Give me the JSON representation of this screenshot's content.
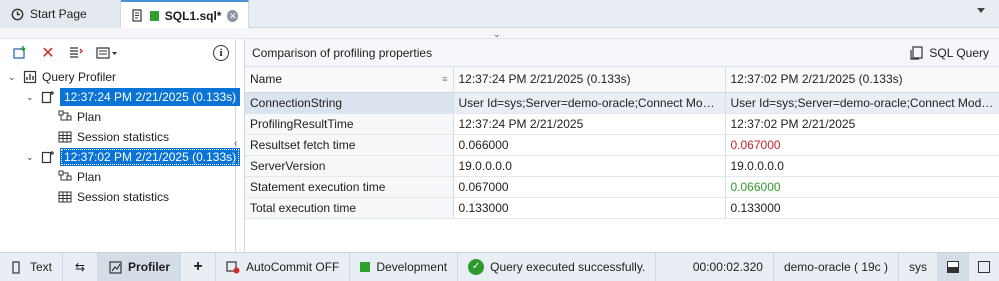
{
  "tabs": {
    "start_page": "Start Page",
    "sql_file": "SQL1.sql*"
  },
  "left": {
    "tree": {
      "root": "Query Profiler",
      "sessions": [
        {
          "label": "12:37:24 PM 2/21/2025 (0.133s)",
          "children": [
            "Plan",
            "Session statistics"
          ]
        },
        {
          "label": "12:37:02 PM 2/21/2025 (0.133s)",
          "children": [
            "Plan",
            "Session statistics"
          ]
        }
      ]
    }
  },
  "right": {
    "title": "Comparison of profiling properties",
    "sql_query_label": "SQL Query",
    "table": {
      "headers": [
        "Name",
        "12:37:24 PM 2/21/2025 (0.133s)",
        "12:37:02 PM 2/21/2025 (0.133s)"
      ],
      "rows": [
        [
          "ConnectionString",
          "User Id=sys;Server=demo-oracle;Connect Mode=S...",
          "User Id=sys;Server=demo-oracle;Connect Mode=S..."
        ],
        [
          "ProfilingResultTime",
          "12:37:24 PM 2/21/2025",
          "12:37:02 PM 2/21/2025"
        ],
        [
          "Resultset fetch time",
          "0.066000",
          "0.067000"
        ],
        [
          "ServerVersion",
          "19.0.0.0.0",
          "19.0.0.0.0"
        ],
        [
          "Statement execution time",
          "0.067000",
          "0.066000"
        ],
        [
          "Total execution time",
          "0.133000",
          "0.133000"
        ]
      ]
    }
  },
  "statusbar": {
    "text_label": "Text",
    "profiler_label": "Profiler",
    "autocommit_label": "AutoCommit OFF",
    "environment": "Development",
    "status_message": "Query executed successfully.",
    "elapsed": "00:00:02.320",
    "connection": "demo-oracle ( 19c )",
    "user": "sys"
  },
  "colors": {
    "selection": "#0a74d6",
    "increase": "#c0272d",
    "decrease": "#2e9a2e",
    "environment": "#2fa12f"
  }
}
